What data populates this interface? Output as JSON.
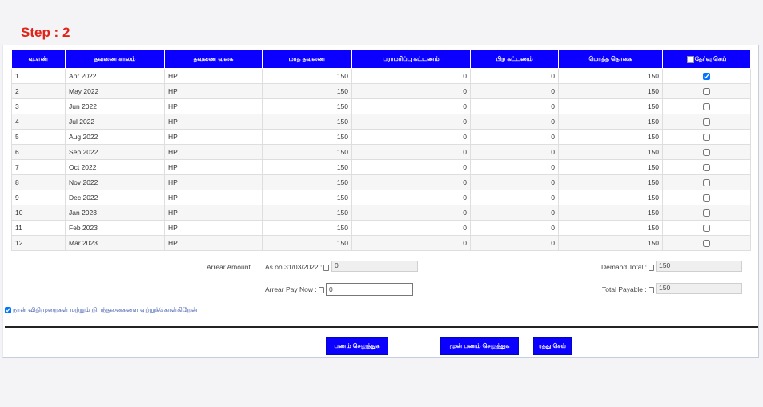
{
  "step_label": "Step : 2",
  "table": {
    "headers": [
      "வ.எண்",
      "தவணை காலம்",
      "தவணை வகை",
      "மாத தவணை",
      "பராமரிப்பு கட்டணம்",
      "பிற கட்டணம்",
      "மொத்த தொகை",
      "தேர்வு செய்"
    ],
    "rows": [
      {
        "sno": "1",
        "period": "Apr 2022",
        "type": "HP",
        "monthly": "150",
        "maint": "0",
        "other": "0",
        "total": "150",
        "selected": true
      },
      {
        "sno": "2",
        "period": "May 2022",
        "type": "HP",
        "monthly": "150",
        "maint": "0",
        "other": "0",
        "total": "150",
        "selected": false
      },
      {
        "sno": "3",
        "period": "Jun 2022",
        "type": "HP",
        "monthly": "150",
        "maint": "0",
        "other": "0",
        "total": "150",
        "selected": false
      },
      {
        "sno": "4",
        "period": "Jul 2022",
        "type": "HP",
        "monthly": "150",
        "maint": "0",
        "other": "0",
        "total": "150",
        "selected": false
      },
      {
        "sno": "5",
        "period": "Aug 2022",
        "type": "HP",
        "monthly": "150",
        "maint": "0",
        "other": "0",
        "total": "150",
        "selected": false
      },
      {
        "sno": "6",
        "period": "Sep 2022",
        "type": "HP",
        "monthly": "150",
        "maint": "0",
        "other": "0",
        "total": "150",
        "selected": false
      },
      {
        "sno": "7",
        "period": "Oct 2022",
        "type": "HP",
        "monthly": "150",
        "maint": "0",
        "other": "0",
        "total": "150",
        "selected": false
      },
      {
        "sno": "8",
        "period": "Nov 2022",
        "type": "HP",
        "monthly": "150",
        "maint": "0",
        "other": "0",
        "total": "150",
        "selected": false
      },
      {
        "sno": "9",
        "period": "Dec 2022",
        "type": "HP",
        "monthly": "150",
        "maint": "0",
        "other": "0",
        "total": "150",
        "selected": false
      },
      {
        "sno": "10",
        "period": "Jan 2023",
        "type": "HP",
        "monthly": "150",
        "maint": "0",
        "other": "0",
        "total": "150",
        "selected": false
      },
      {
        "sno": "11",
        "period": "Feb 2023",
        "type": "HP",
        "monthly": "150",
        "maint": "0",
        "other": "0",
        "total": "150",
        "selected": false
      },
      {
        "sno": "12",
        "period": "Mar 2023",
        "type": "HP",
        "monthly": "150",
        "maint": "0",
        "other": "0",
        "total": "150",
        "selected": false
      }
    ]
  },
  "summary": {
    "arrear_amount_label": "Arrear Amount",
    "as_on_label": "As on 31/03/2022 :",
    "as_on_value": "0",
    "arrear_pay_now_label": "Arrear Pay Now :",
    "arrear_pay_now_value": "0",
    "demand_total_label": "Demand Total :",
    "demand_total_value": "150",
    "total_payable_label": "Total Payable :",
    "total_payable_value": "150"
  },
  "agreement": {
    "label": "நான் விதிமுறைகள் மற்றும் நிபந்தனைகளை ஏற்றுக்கொள்கிறேன்",
    "checked": true
  },
  "buttons": {
    "pay": "பணம் செலுத்துக",
    "advance_pay": "முன் பணம் செலுத்துக",
    "cancel": "ரத்து செய்"
  },
  "colors": {
    "accent": "#0b00ff",
    "step": "#e2231a"
  }
}
